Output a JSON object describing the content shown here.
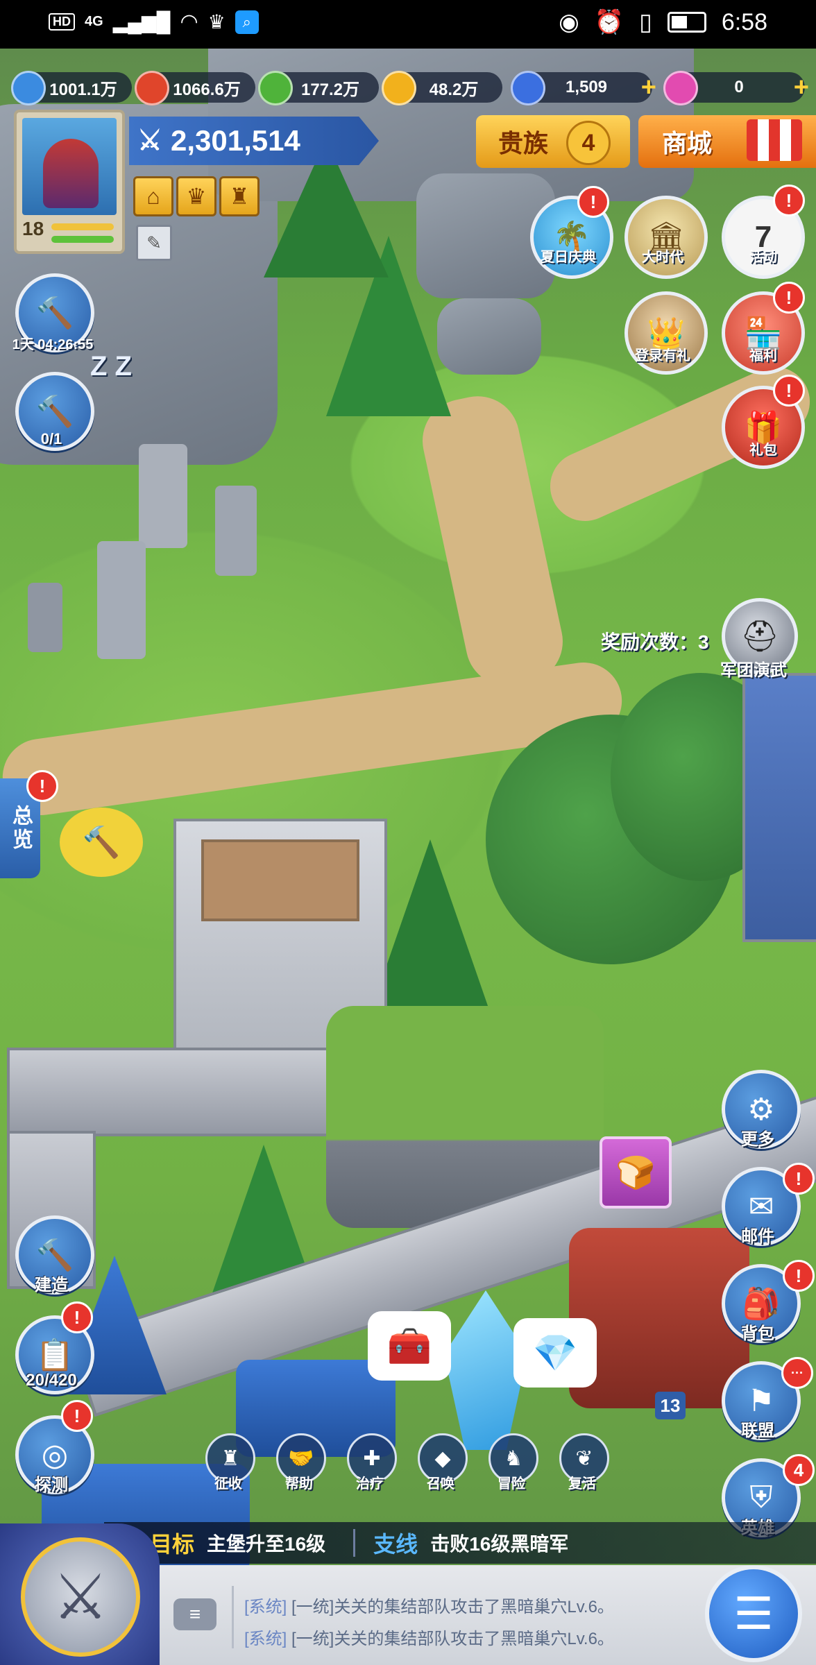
{
  "status_bar": {
    "left_indicators": [
      "HD",
      "4G"
    ],
    "time": "6:58"
  },
  "resources": [
    {
      "name": "water",
      "value": "1001.1万",
      "color": "#3b8be0"
    },
    {
      "name": "fire",
      "value": "1066.6万",
      "color": "#e0452b"
    },
    {
      "name": "plant",
      "value": "177.2万",
      "color": "#4fb33a"
    },
    {
      "name": "gold",
      "value": "48.2万",
      "color": "#f2b11c"
    },
    {
      "name": "crystal",
      "value": "1,509",
      "color": "#3b6fe0"
    },
    {
      "name": "gem",
      "value": "0",
      "color": "#e24bb0"
    }
  ],
  "player": {
    "level": "18",
    "power": "2,301,514"
  },
  "header_buttons": {
    "noble_label": "贵族",
    "noble_level": "4",
    "shop_label": "商城"
  },
  "events": {
    "summer": "夏日庆典",
    "era": "大时代",
    "activity": "活动",
    "activity_day": "7",
    "login_gift": "登录有礼",
    "welfare": "福利",
    "gift_pack": "礼包"
  },
  "left_buttons": {
    "build_timer": "1天 04:26:55",
    "queue_count": "0/1",
    "sleep": "Z Z",
    "overview": "总览"
  },
  "legion": {
    "reward_text": "奖励次数：3",
    "label": "军团演武"
  },
  "right_menu": {
    "more": "更多",
    "mail": "邮件",
    "bag": "背包",
    "alliance": "联盟",
    "hero": "英雄",
    "hero_badge": "4",
    "alliance_badge": "···",
    "alert": "!"
  },
  "bottom_left": {
    "build": "建造",
    "task_count": "20/420",
    "explore": "探测"
  },
  "city_actions": [
    "征收",
    "帮助",
    "治疗",
    "召唤",
    "冒险",
    "复活"
  ],
  "tile_level": "13",
  "goals": {
    "main_tag": "目标",
    "main_text": "主堡升至16级",
    "side_tag": "支线",
    "side_text": "击败16级黑暗军"
  },
  "chat": [
    {
      "channel": "[系统]",
      "text": "[一统]关关的集结部队攻击了黑暗巢穴Lv.6。"
    },
    {
      "channel": "[系统]",
      "text": "[一统]关关的集结部队攻击了黑暗巢穴Lv.6。"
    }
  ]
}
